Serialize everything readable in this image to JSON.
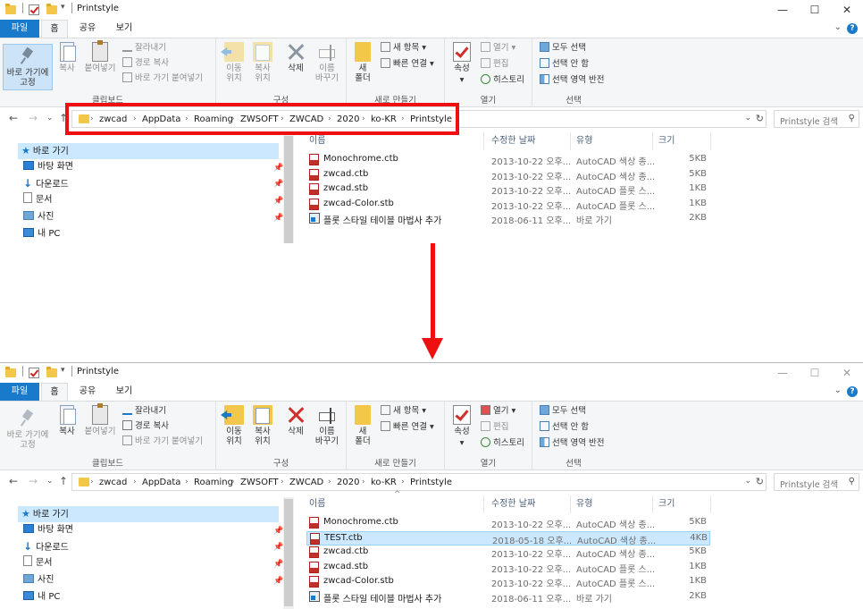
{
  "window_title": "Printstyle",
  "window_controls": {
    "minimize": "—",
    "maximize": "☐",
    "close": "✕"
  },
  "tabs": {
    "file": "파일",
    "home": "홈",
    "share": "공유",
    "view": "보기"
  },
  "ribbon": {
    "clipboard": {
      "group_label": "클립보드",
      "pin": "바로 가기에\n고정",
      "copy": "복사",
      "paste": "붙여넣기",
      "cut": "잘라내기",
      "copy_path": "경로 복사",
      "paste_shortcut": "바로 가기 붙여넣기"
    },
    "organize": {
      "group_label": "구성",
      "move_to": "이동\n위치",
      "copy_to": "복사\n위치",
      "delete": "삭제",
      "rename": "이름\n바꾸기"
    },
    "new": {
      "group_label": "새로 만들기",
      "new_folder": "새\n폴더",
      "new_item": "새 항목",
      "easy_access": "빠른 연결"
    },
    "open": {
      "group_label": "열기",
      "properties": "속성",
      "open": "열기",
      "edit": "편집",
      "history": "히스토리"
    },
    "select": {
      "group_label": "선택",
      "select_all": "모두 선택",
      "select_none": "선택 안 함",
      "invert": "선택 영역 반전"
    }
  },
  "address": {
    "crumbs": [
      "zwcad",
      "AppData",
      "Roaming",
      "ZWSOFT",
      "ZWCAD",
      "2020",
      "ko-KR",
      "Printstyle"
    ],
    "search_placeholder": "Printstyle 검색"
  },
  "nav": {
    "quick_access": "바로 가기",
    "items": [
      "바탕 화면",
      "다운로드",
      "문서",
      "사진",
      "내 PC"
    ]
  },
  "columns": {
    "name": "이름",
    "modified": "수정한 날짜",
    "type": "유형",
    "size": "크기"
  },
  "files_before": [
    {
      "name": "Monochrome.ctb",
      "modified": "2013-10-22 오후...",
      "type": "AutoCAD 색상 종...",
      "size": "5KB",
      "kind": "file"
    },
    {
      "name": "zwcad.ctb",
      "modified": "2013-10-22 오후...",
      "type": "AutoCAD 색상 종...",
      "size": "5KB",
      "kind": "file"
    },
    {
      "name": "zwcad.stb",
      "modified": "2013-10-22 오후...",
      "type": "AutoCAD 플롯 스...",
      "size": "1KB",
      "kind": "file"
    },
    {
      "name": "zwcad-Color.stb",
      "modified": "2013-10-22 오후...",
      "type": "AutoCAD 플롯 스...",
      "size": "1KB",
      "kind": "file"
    },
    {
      "name": "플롯 스타일 테이블 마법사 추가",
      "modified": "2018-06-11 오후...",
      "type": "바로 가기",
      "size": "2KB",
      "kind": "link"
    }
  ],
  "files_after": [
    {
      "name": "Monochrome.ctb",
      "modified": "2013-10-22 오후...",
      "type": "AutoCAD 색상 종...",
      "size": "5KB",
      "kind": "file"
    },
    {
      "name": "TEST.ctb",
      "modified": "2018-05-18 오후...",
      "type": "AutoCAD 색상 종...",
      "size": "4KB",
      "kind": "file",
      "selected": true
    },
    {
      "name": "zwcad.ctb",
      "modified": "2013-10-22 오후...",
      "type": "AutoCAD 색상 종...",
      "size": "5KB",
      "kind": "file"
    },
    {
      "name": "zwcad.stb",
      "modified": "2013-10-22 오후...",
      "type": "AutoCAD 플롯 스...",
      "size": "1KB",
      "kind": "file"
    },
    {
      "name": "zwcad-Color.stb",
      "modified": "2013-10-22 오후...",
      "type": "AutoCAD 플롯 스...",
      "size": "1KB",
      "kind": "file"
    },
    {
      "name": "플롯 스타일 테이블 마법사 추가",
      "modified": "2018-06-11 오후...",
      "type": "바로 가기",
      "size": "2KB",
      "kind": "link"
    }
  ],
  "accent_colors": {
    "ribbon_file_tab": "#1979ca",
    "selection": "#cce8ff",
    "annotation_red": "#ee1010"
  }
}
